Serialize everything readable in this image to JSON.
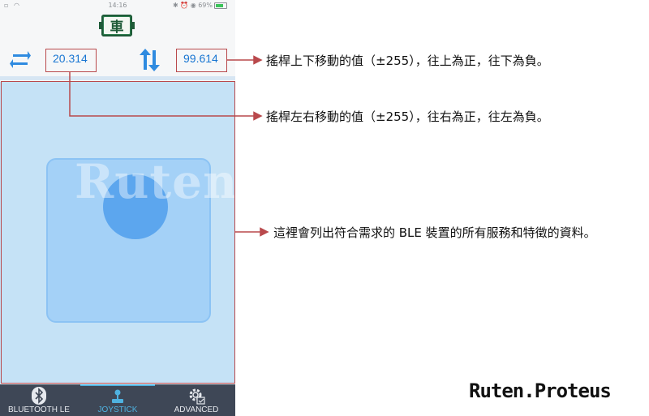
{
  "statusbar": {
    "time": "14:16",
    "left_icons": "▫ ◠",
    "right_icons": "✱ ⏰ ◉ 69%"
  },
  "app": {
    "logo_text": "車"
  },
  "readouts": {
    "x_value": "20.314",
    "y_value": "99.614"
  },
  "icons": {
    "lr": "left-right-arrows-icon",
    "ud": "up-down-arrows-icon"
  },
  "watermark": "Ruten.Proteus",
  "tabs": [
    {
      "label": "BLUETOOTH LE",
      "icon": "bluetooth-icon",
      "active": false
    },
    {
      "label": "JOYSTICK",
      "icon": "joystick-icon",
      "active": true
    },
    {
      "label": "ADVANCED",
      "icon": "gear-icon",
      "active": false
    }
  ],
  "annotations": {
    "y_note": "搖桿上下移動的值（±255），往上為正，往下為負。",
    "x_note": "搖桿左右移動的值（±255），往右為正，往左為負。",
    "area_note": "這裡會列出符合需求的 BLE 裝置的所有服務和特徵的資料。"
  },
  "brand": "Ruten.Proteus",
  "colors": {
    "accent": "#1976d2",
    "annotation_red": "#b9494c",
    "joystick_bg": "#c5e2f6",
    "knob": "#5ca6ee",
    "nav_bg": "#3e4756"
  }
}
